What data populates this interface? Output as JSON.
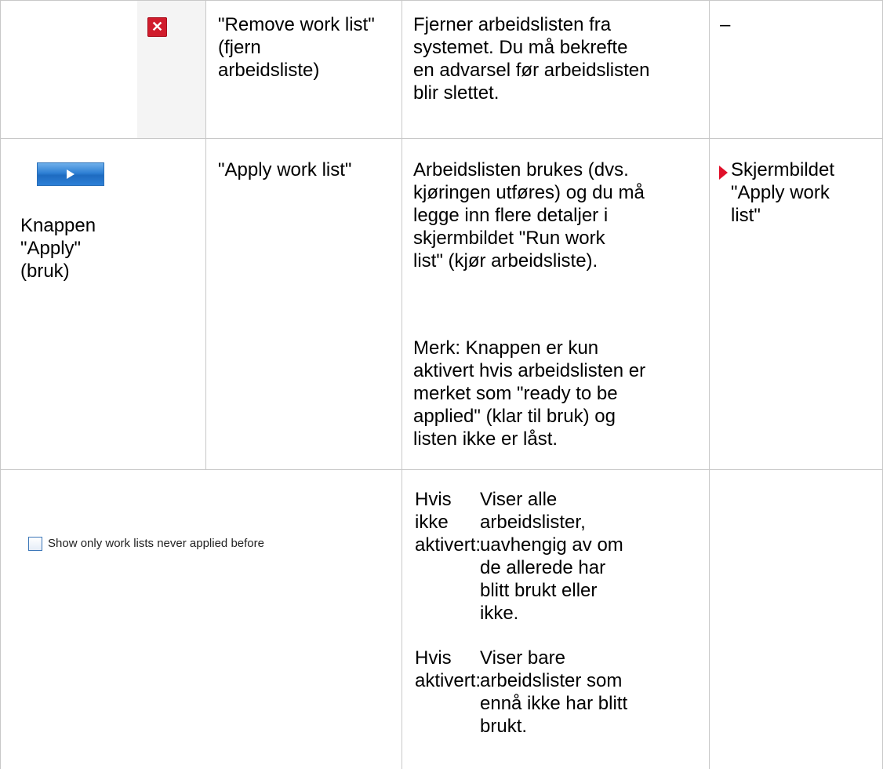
{
  "rows": [
    {
      "icon": "close-x-icon",
      "function": "\"Remove work list\"\n(fjern\narbeidsliste)",
      "description": "Fjerner arbeidslisten fra\nsystemet. Du må bekrefte\nen advarsel før arbeidslisten\nblir slettet.",
      "reference": "–"
    },
    {
      "element": "Knappen\n\"Apply\"\n(bruk)",
      "icon": "play-arrow-icon",
      "function": "\"Apply work list\"",
      "description": "Arbeidslisten brukes (dvs.\nkjøringen utføres) og du må\nlegge inn flere detaljer i\nskjermbildet \"Run work\nlist\" (kjør arbeidsliste).",
      "note": "Merk: Knappen er kun\naktivert hvis arbeidslisten er\nmerket som \"ready to be\napplied\" (klar til bruk) og\nlisten ikke er låst.",
      "reference": "Skjermbildet\n\"Apply work\nlist\""
    },
    {
      "checkbox_label": "Show only work lists never applied before",
      "checkbox_checked": false,
      "conditions": [
        {
          "label": "Hvis\nikke\naktivert:",
          "text": "Viser alle\narbeidslister,\nuavhengig av om\nde allerede har\nblitt brukt eller\nikke."
        },
        {
          "label": "Hvis\naktivert:",
          "text": "Viser bare\narbeidslister som\nennå ikke har blitt\nbrukt."
        }
      ]
    }
  ]
}
